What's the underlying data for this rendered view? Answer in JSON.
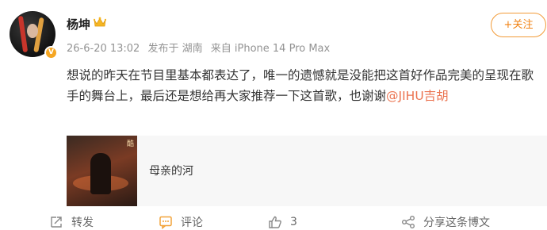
{
  "user": {
    "name": "杨坤",
    "avatar_badge": "V"
  },
  "meta": {
    "time": "26-6-20 13:02",
    "location": "发布于 湖南",
    "source": "来自 iPhone 14 Pro Max"
  },
  "follow_button": "+关注",
  "post": {
    "text_before_mention": "想说的昨天在节目里基本都表达了，唯一的遗憾就是没能把这首好作品完美的呈现在歌手的舞台上，最后还是想给再大家推荐一下这首歌，也谢谢",
    "mention": "@JIHU吉胡"
  },
  "card": {
    "title": "母亲的河",
    "cover_corner_text": "酷"
  },
  "actions": {
    "repost": "转发",
    "comment": "评论",
    "like": "3",
    "share": "分享这条博文"
  },
  "colors": {
    "accent_orange": "#f18212",
    "mention": "#eb7350",
    "meta_gray": "#939393",
    "badge_gold": "#f5a623"
  },
  "icons": [
    "crown-icon",
    "verified-badge-icon",
    "repost-icon",
    "comment-icon",
    "like-icon",
    "share-icon"
  ]
}
